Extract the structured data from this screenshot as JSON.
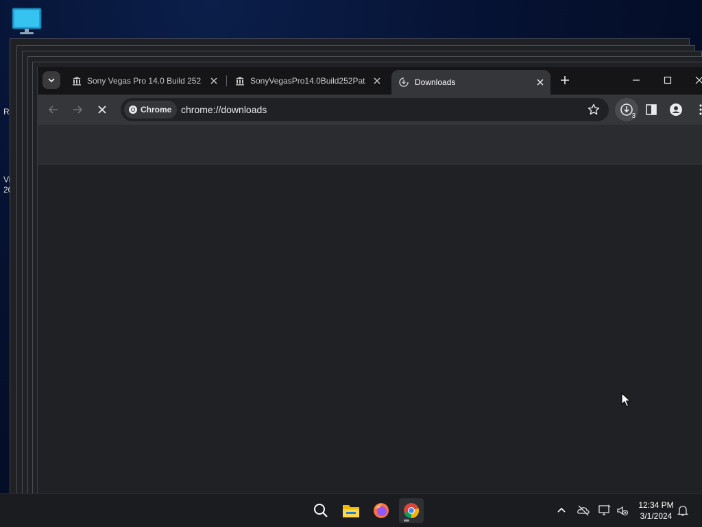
{
  "desktop": {
    "icon_label_partial_1": "R",
    "icon_label_partial_2a": "Vi",
    "icon_label_partial_2b": "20"
  },
  "browser": {
    "tabs": [
      {
        "label": "Sony Vegas Pro 14.0 Build 252",
        "icon": "museum-icon",
        "active": false
      },
      {
        "label": "SonyVegasPro14.0Build252Patc",
        "icon": "museum-icon",
        "active": false
      },
      {
        "label": "Downloads",
        "icon": "downloads-page-icon",
        "active": true
      }
    ],
    "omnibox": {
      "chip_label": "Chrome",
      "url": "chrome://downloads"
    },
    "downloads_count": "3"
  },
  "taskbar": {
    "apps": [
      "search-icon",
      "file-explorer-icon",
      "firefox-icon",
      "chrome-icon"
    ],
    "clock_time": "12:34 PM",
    "clock_date": "3/1/2024"
  },
  "colors": {
    "desktop_bg": "#061233",
    "tabstrip_bg": "#151517",
    "toolbar_bg": "#35363a",
    "content_bg": "#202124",
    "taskbar_bg": "#1b1c20"
  }
}
